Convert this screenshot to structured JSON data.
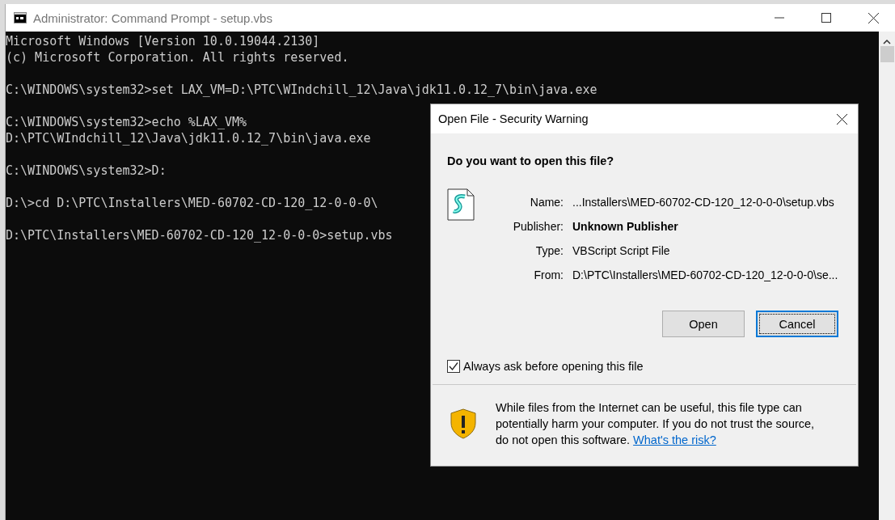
{
  "window": {
    "title": "Administrator: Command Prompt - setup.vbs"
  },
  "console": {
    "blocks": [
      [
        "Microsoft Windows [Version 10.0.19044.2130]",
        "(c) Microsoft Corporation. All rights reserved."
      ],
      [
        "C:\\WINDOWS\\system32>set LAX_VM=D:\\PTC\\WIndchill_12\\Java\\jdk11.0.12_7\\bin\\java.exe"
      ],
      [
        "C:\\WINDOWS\\system32>echo %LAX_VM%",
        "D:\\PTC\\WIndchill_12\\Java\\jdk11.0.12_7\\bin\\java.exe"
      ],
      [
        "C:\\WINDOWS\\system32>D:"
      ],
      [
        "D:\\>cd D:\\PTC\\Installers\\MED-60702-CD-120_12-0-0-0\\"
      ],
      [
        "D:\\PTC\\Installers\\MED-60702-CD-120_12-0-0-0>setup.vbs"
      ]
    ]
  },
  "dialog": {
    "title": "Open File - Security Warning",
    "heading": "Do you want to open this file?",
    "fields": [
      {
        "label": "Name:",
        "value": "...Installers\\MED-60702-CD-120_12-0-0-0\\setup.vbs",
        "bold": false
      },
      {
        "label": "Publisher:",
        "value": "Unknown Publisher",
        "bold": true
      },
      {
        "label": "Type:",
        "value": "VBScript Script File",
        "bold": false
      },
      {
        "label": "From:",
        "value": "D:\\PTC\\Installers\\MED-60702-CD-120_12-0-0-0\\se...",
        "bold": false
      }
    ],
    "buttons": [
      {
        "label": "Open",
        "selected": false
      },
      {
        "label": "Cancel",
        "selected": true
      }
    ],
    "checkbox": {
      "label": "Always ask before opening this file",
      "checked": true
    },
    "warning": {
      "text": "While files from the Internet can be useful, this file type can potentially harm your computer. If you do not trust the source, do not open this software.",
      "link": "What's the risk?"
    }
  }
}
